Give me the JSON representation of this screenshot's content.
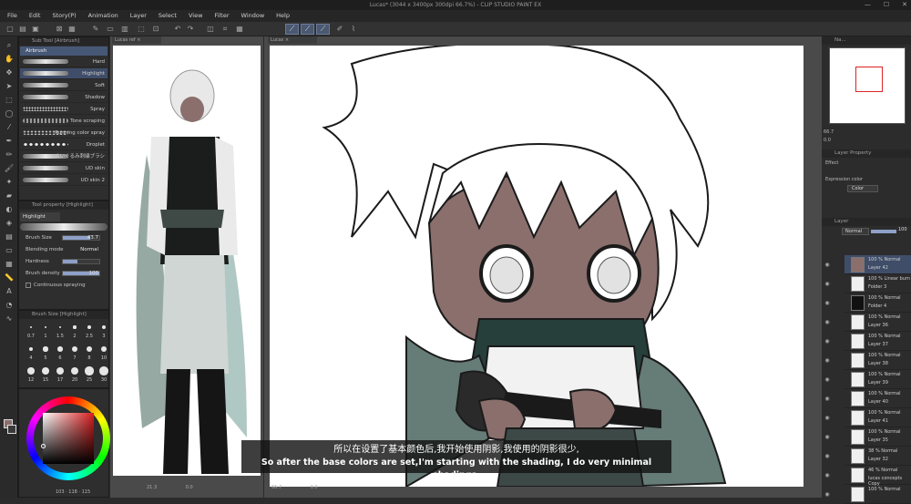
{
  "title_bar": {
    "text": "Lucas* (3044 x 3400px 300dpi 66.7%) - CLIP STUDIO PAINT EX"
  },
  "menu": [
    "File",
    "Edit",
    "Story(P)",
    "Animation",
    "Layer",
    "Select",
    "View",
    "Filter",
    "Window",
    "Help"
  ],
  "brush_panel": {
    "header": "Sub Tool [Airbrush]",
    "group": "Airbrush",
    "items": [
      "Hard",
      "Highlight",
      "Soft",
      "Shadow",
      "Spray",
      "Tone scraping",
      "Running color spray",
      "Droplet",
      "ぬいぐるみ刺繍ブラシ",
      "UD skin",
      "UD skin 2"
    ],
    "selected": "Highlight"
  },
  "tool_property": {
    "header": "Tool property [Highlight]",
    "name": "Highlight",
    "brush_size_label": "Brush Size",
    "brush_size": "43.7",
    "blending_label": "Blending mode",
    "blending_value": "Normal",
    "hardness_label": "Hardness",
    "density_label": "Brush density",
    "density": "100",
    "continuous_label": "Continuous spraying"
  },
  "brush_size_panel": {
    "header": "Brush Size [Highlight]",
    "sizes": [
      "0.7",
      "1",
      "1.5",
      "2",
      "2.5",
      "3",
      "4",
      "5",
      "6",
      "7",
      "8",
      "10",
      "12",
      "15",
      "17",
      "20",
      "25",
      "30"
    ]
  },
  "color_readout": "103 · 118 · 115",
  "ref_tab": "Lucas ref",
  "canvas_tab": "Lucas",
  "ref_zoom": "21.3",
  "ref_angle": "0.0",
  "canvas_zoom": "66.7",
  "canvas_angle": "0.0",
  "navigator": {
    "header": "Na...",
    "zoom": "66.7",
    "angle": "0.0"
  },
  "layer_property": {
    "header": "Layer Property",
    "effect_label": "Effect",
    "expression_label": "Expression color",
    "expression_value": "Color"
  },
  "layers_panel": {
    "header": "Layer",
    "blend": "Normal",
    "opacity": "100",
    "layers": [
      {
        "mode": "100 % Normal",
        "name": "Layer 42"
      },
      {
        "mode": "100 % Linear burn",
        "name": "Folder 3"
      },
      {
        "mode": "100 % Normal",
        "name": "Folder 4"
      },
      {
        "mode": "100 % Normal",
        "name": "Layer 36"
      },
      {
        "mode": "100 % Normal",
        "name": "Layer 37"
      },
      {
        "mode": "100 % Normal",
        "name": "Layer 38"
      },
      {
        "mode": "100 % Normal",
        "name": "Layer 39"
      },
      {
        "mode": "100 % Normal",
        "name": "Layer 40"
      },
      {
        "mode": "100 % Normal",
        "name": "Layer 41"
      },
      {
        "mode": "100 % Normal",
        "name": "Layer 35"
      },
      {
        "mode": "38 % Normal",
        "name": "Layer 32"
      },
      {
        "mode": "46 % Normal",
        "name": "lucas concepts Copy"
      },
      {
        "mode": "100 % Normal",
        "name": ""
      }
    ]
  },
  "subtitles": {
    "zh": "所以在设置了基本颜色后,我开始使用阴影,我使用的阴影很少,",
    "en": "So after the base colors are set,I'm starting with the shading, I do very minimal shadings,"
  },
  "colors": {
    "accent": "#5a6a8c",
    "skin": "#8a6f6c",
    "cloak": "#667c76"
  }
}
